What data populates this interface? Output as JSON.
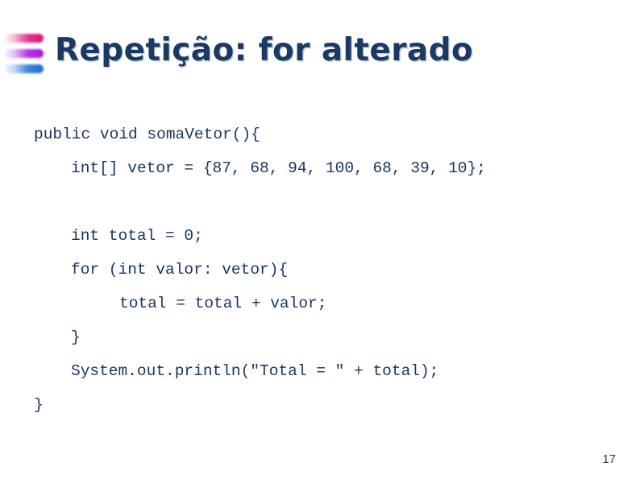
{
  "slide": {
    "title": "Repetição: for alterado",
    "page_number": "17",
    "background_color": "#ffffff",
    "title_color": "#1b3a63",
    "code_color": "#17365d",
    "bullet_icon": {
      "name": "three-bar-gradient-bullet-icon",
      "bar_colors": [
        "#e0117f",
        "#a614e0",
        "#1f6fd4"
      ]
    },
    "code_lines": [
      {
        "indent": 0,
        "text": "public void somaVetor(){"
      },
      {
        "indent": 1,
        "text": "int[] vetor = {87, 68, 94, 100, 68, 39, 10};"
      },
      {
        "indent": 0,
        "text": ""
      },
      {
        "indent": 1,
        "text": "int total = 0;"
      },
      {
        "indent": 1,
        "text": "for (int valor: vetor){"
      },
      {
        "indent": 2,
        "text": "total = total + valor;"
      },
      {
        "indent": 1,
        "text": "}"
      },
      {
        "indent": 1,
        "text": "System.out.println(\"Total = \" + total);"
      },
      {
        "indent": 0,
        "text": "}"
      }
    ]
  }
}
